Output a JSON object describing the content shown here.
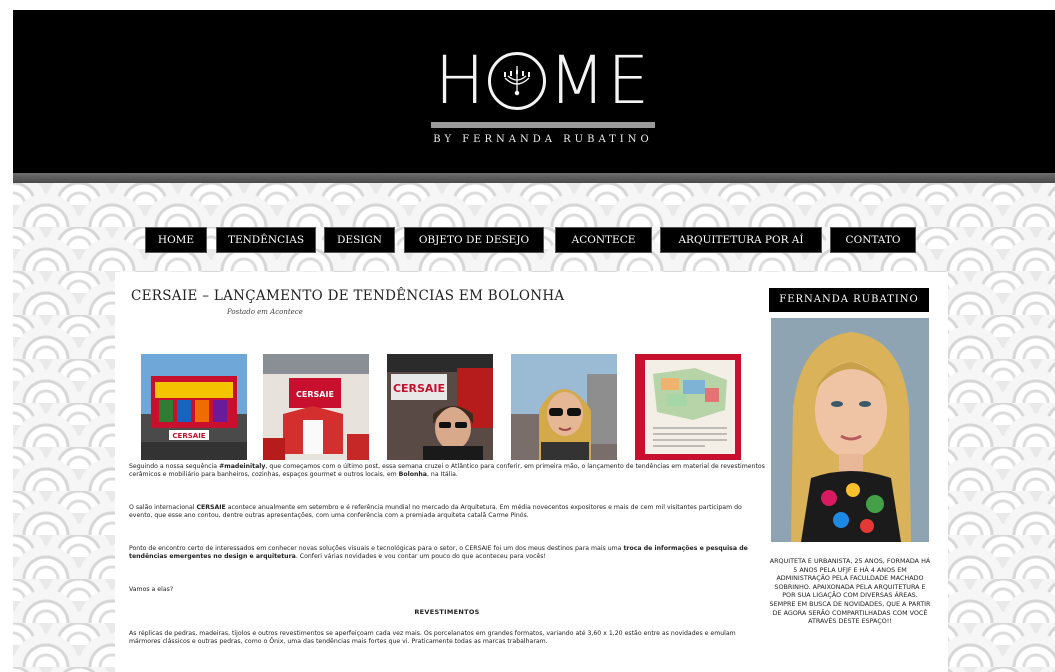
{
  "header": {
    "logo_word_left": "H",
    "logo_word_right": "ME",
    "logo_subtitle": "BY FERNANDA RUBATINO"
  },
  "nav": {
    "items": [
      {
        "label": "HOME"
      },
      {
        "label": "TENDÊNCIAS"
      },
      {
        "label": "DESIGN"
      },
      {
        "label": "OBJETO DE DESEJO"
      },
      {
        "label": "ACONTECE"
      },
      {
        "label": "ARQUITETURA POR AÍ"
      },
      {
        "label": "CONTATO"
      }
    ]
  },
  "post": {
    "title": "CERSAIE – LANÇAMENTO DE TENDÊNCIAS EM BOLONHA",
    "meta": "Postado em Acontece",
    "photos": [
      {
        "caption": "CERSAIE",
        "name": "cersaie-stand-photo"
      },
      {
        "caption": "CERSAIE",
        "name": "cersaie-booth-photo"
      },
      {
        "caption": "CERSAIE",
        "name": "cersaie-entrance-photo"
      },
      {
        "caption": "",
        "name": "selfie-photo"
      },
      {
        "caption": "",
        "name": "map-photo"
      }
    ],
    "p1_a": "Seguindo a nossa sequência ",
    "p1_b": "#madeinitaly",
    "p1_c": ", que começamos com o último post, essa semana cruzei o Atlântico para conferir, em primeira mão, o lançamento de tendências em material de revestimentos cerâmicos e mobiliário para banheiros, cozinhas, espaços gourmet e outros locais, em ",
    "p1_d": "Bolonha",
    "p1_e": ", na Itália.",
    "p2_a": "O salão internacional ",
    "p2_b": "CERSAIE",
    "p2_c": " acontece anualmente em setembro e é referência mundial no mercado da Arquitetura. Em média novecentos expositores e mais de cem mil visitantes participam do evento, que esse ano contou, dentre outras apresentações, com uma conferência com a premiada arquiteta catalã Carme Pinós.",
    "p3_a": "Ponto de encontro certo de interessados em conhecer novas soluções visuais e tecnológicas para o setor, o CERSAIE foi um dos meus destinos para mais uma ",
    "p3_b": "troca de informações e pesquisa de tendências emergentes no design e arquitetura",
    "p3_c": ". Conferi várias novidades e vou contar um pouco do que aconteceu para vocês!",
    "p4": "Vamos a elas?",
    "subhead": "REVESTIMENTOS",
    "p5": "As réplicas de pedras, madeiras, tijolos e outros revestimentos se aperfeiçoam cada vez mais. Os porcelanatos em grandes formatos, variando até 3,60 x 1,20 estão entre as novidades e emulam mármores clássicos e outras pedras, como o Ônix, uma das tendências mais fortes que vi. Praticamente todas as marcas trabalharam."
  },
  "sidebar": {
    "title": "FERNANDA RUBATINO",
    "bio": "Arquiteta e urbanista, 25 anos, formada há 5 anos pela UFJF e há 4 anos em administração pela faculdade Machado Sobrinho. Apaixonada pela arquitetura e por sua ligação com diversas áreas. Sempre em busca de novidades, que a partir de agora serão compartilhadas com você através deste espaço!!"
  },
  "colors": {
    "header_bg": "#000000",
    "nav_bg": "#000000",
    "accent_red": "#c8102e"
  }
}
